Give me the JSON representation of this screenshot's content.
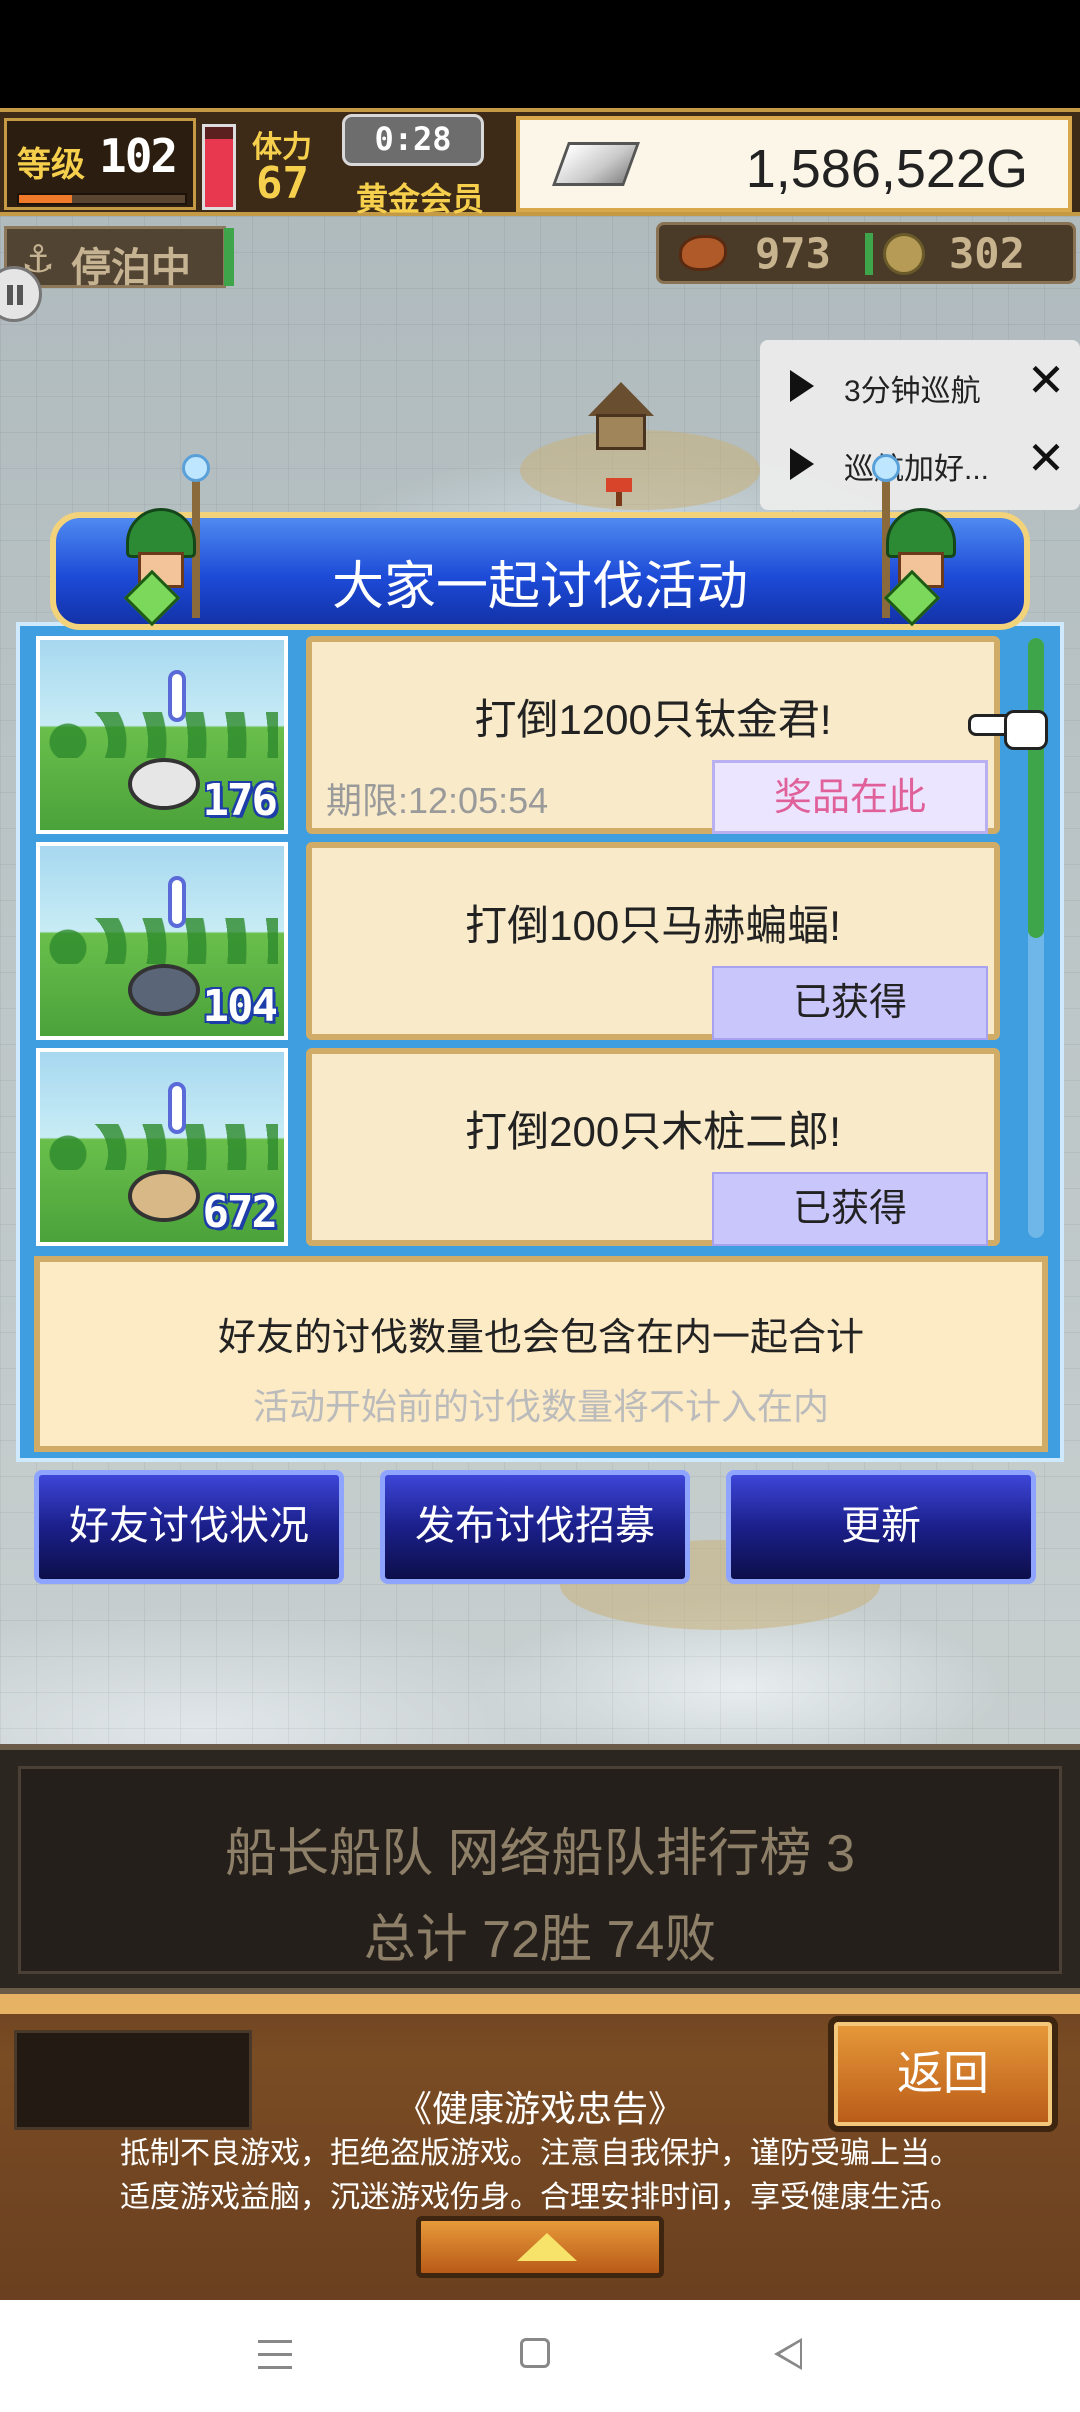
{
  "hud": {
    "level_label": "等级",
    "level_value": "102",
    "level_progress": 0.32,
    "stamina_label": "体力",
    "stamina_value": "67",
    "stamina_fill": 0.85,
    "timer": "0:28",
    "membership": "黄金会员",
    "gold": "1,586,522G"
  },
  "status_row": {
    "dock_status": "停泊中",
    "resource1": "973",
    "resource2": "302"
  },
  "notifications": [
    {
      "label": "3分钟巡航"
    },
    {
      "label": "巡航加好..."
    }
  ],
  "event": {
    "title": "大家一起讨伐活动",
    "quests": [
      {
        "title": "打倒1200只钛金君!",
        "count": "176",
        "deadline": "期限:12:05:54",
        "button": "奖品在此"
      },
      {
        "title": "打倒100只马赫蝙蝠!",
        "count": "104",
        "deadline": "",
        "button": "已获得"
      },
      {
        "title": "打倒200只木桩二郎!",
        "count": "672",
        "deadline": "",
        "button": "已获得"
      }
    ],
    "info_line1": "好友的讨伐数量也会包含在内一起合计",
    "info_line2": "活动开始前的讨伐数量将不计入在内",
    "buttons": {
      "friends": "好友讨伐状况",
      "recruit": "发布讨伐招募",
      "refresh": "更新"
    }
  },
  "fleet": {
    "line1": "船长船队  网络船队排行榜  3",
    "line2": "总计 72胜 74败"
  },
  "bottom": {
    "back_label": "返回",
    "advisory_title": "《健康游戏忠告》",
    "advisory_line1": "抵制不良游戏，拒绝盗版游戏。注意自我保护，谨防受骗上当。",
    "advisory_line2": "适度游戏益脑，沉迷游戏伤身。合理安排时间，享受健康生活。"
  },
  "colors": {
    "dialog_blue": "#1d4bd8",
    "card_bg": "#f9ebc9",
    "claimed_btn": "#c9c6fb",
    "prize_text": "#e0609a"
  }
}
